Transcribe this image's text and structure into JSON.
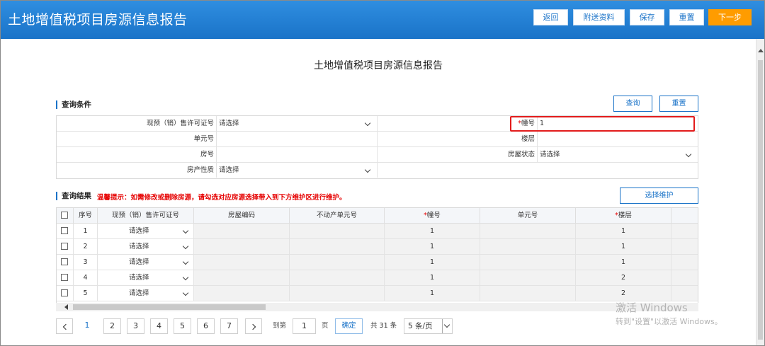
{
  "header": {
    "title": "土地增值税项目房源信息报告",
    "buttons": [
      "返回",
      "附送资料",
      "保存",
      "重置",
      "下一步"
    ]
  },
  "page_title": "土地增值税项目房源信息报告",
  "query": {
    "section_label": "查询条件",
    "search_label": "查询",
    "reset_label": "重置",
    "permit_label": "现预（销）售许可证号",
    "permit_value": "请选择",
    "building_req": "*",
    "building_label": "幢号",
    "building_value": "1",
    "unit_label": "单元号",
    "unit_value": "",
    "floor_label": "楼层",
    "floor_value": "",
    "room_label": "房号",
    "room_value": "",
    "status_label": "房屋状态",
    "status_value": "请选择",
    "property_label": "房产性质",
    "property_value": "请选择"
  },
  "result": {
    "section_label": "查询结果",
    "tip": "温馨提示：如需修改或删除房源，请勾选对应房源选择带入到下方维护区进行维护。",
    "maintain_label": "选择维护",
    "columns": [
      "序号",
      "现预（销）售许可证号",
      "房屋编码",
      "不动产单元号",
      "幢号",
      "单元号",
      "楼层"
    ],
    "req_mark": "*",
    "rows": [
      {
        "no": "1",
        "permit": "请选择",
        "building": "1",
        "floor": "1"
      },
      {
        "no": "2",
        "permit": "请选择",
        "building": "1",
        "floor": "1"
      },
      {
        "no": "3",
        "permit": "请选择",
        "building": "1",
        "floor": "1"
      },
      {
        "no": "4",
        "permit": "请选择",
        "building": "1",
        "floor": "2"
      },
      {
        "no": "5",
        "permit": "请选择",
        "building": "1",
        "floor": "2"
      }
    ]
  },
  "pagination": {
    "pages": [
      "1",
      "2",
      "3",
      "4",
      "5",
      "6",
      "7"
    ],
    "goto_prefix": "到第",
    "goto_value": "1",
    "goto_suffix": "页",
    "confirm": "确定",
    "total": "共 31 条",
    "page_size": "5 条/页"
  },
  "watermark": {
    "line1": "激活 Windows",
    "line2": "转到\"设置\"以激活 Windows。"
  },
  "colors": {
    "header_blue": "#1a73c8",
    "next_orange": "#ff9c00",
    "highlight_red": "#e21b1b",
    "tip_red": "#e60000"
  }
}
